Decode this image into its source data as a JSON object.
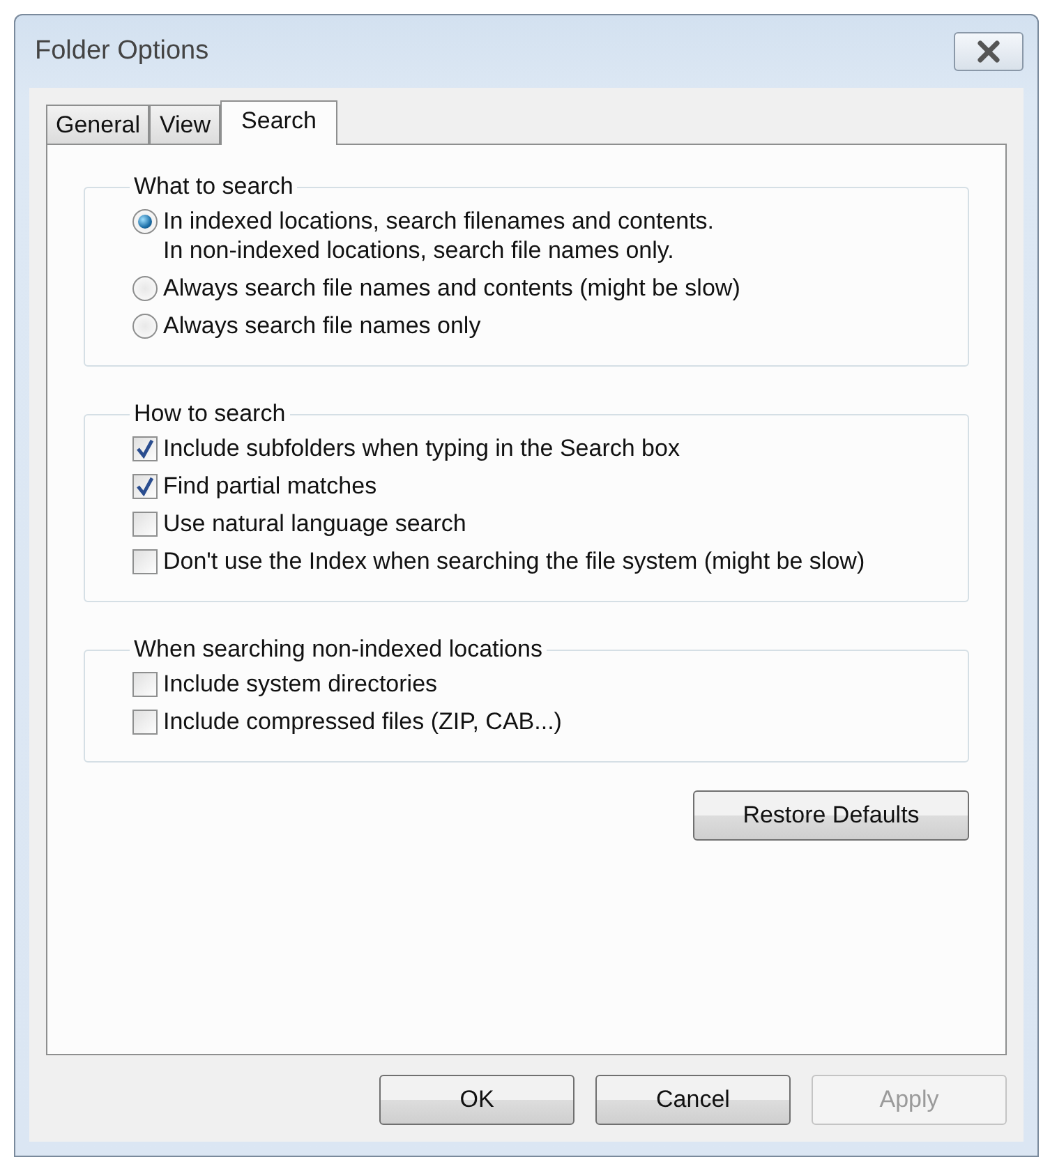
{
  "window": {
    "title": "Folder Options"
  },
  "tabs": [
    {
      "label": "General",
      "selected": false
    },
    {
      "label": "View",
      "selected": false
    },
    {
      "label": "Search",
      "selected": true
    }
  ],
  "groups": [
    {
      "title": "What to search",
      "options": [
        {
          "kind": "radio",
          "label": "In indexed locations, search filenames and contents.\nIn non-indexed locations, search file names only.",
          "selected": true
        },
        {
          "kind": "radio",
          "label": "Always search file names and contents (might be slow)",
          "selected": false
        },
        {
          "kind": "radio",
          "label": "Always search file names only",
          "selected": false
        }
      ]
    },
    {
      "title": "How to search",
      "options": [
        {
          "kind": "checkbox",
          "label": "Include subfolders when typing in the Search box",
          "checked": true
        },
        {
          "kind": "checkbox",
          "label": "Find partial matches",
          "checked": true
        },
        {
          "kind": "checkbox",
          "label": "Use natural language search",
          "checked": false
        },
        {
          "kind": "checkbox",
          "label": "Don't use the Index when searching the file system (might be slow)",
          "checked": false
        }
      ]
    },
    {
      "title": "When searching non-indexed locations",
      "options": [
        {
          "kind": "checkbox",
          "label": "Include system directories",
          "checked": false
        },
        {
          "kind": "checkbox",
          "label": "Include compressed files (ZIP, CAB...)",
          "checked": false
        }
      ]
    }
  ],
  "restore_button": "Restore Defaults",
  "buttons": [
    {
      "label": "OK",
      "disabled": false
    },
    {
      "label": "Cancel",
      "disabled": false
    },
    {
      "label": "Apply",
      "disabled": true
    }
  ]
}
